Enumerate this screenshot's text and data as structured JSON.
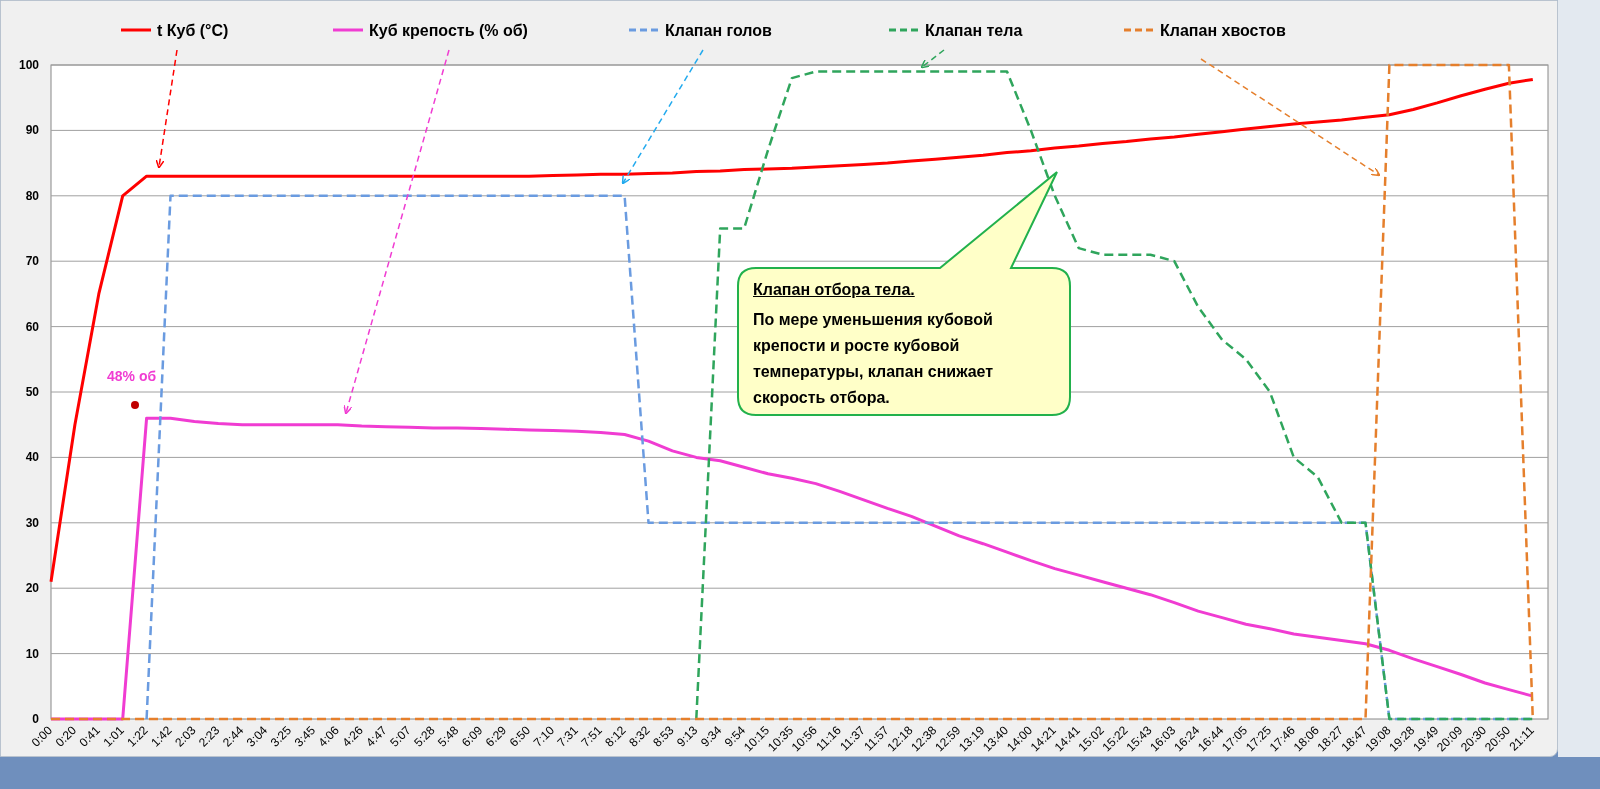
{
  "chart_data": {
    "type": "line",
    "categories": [
      "0:00",
      "0:20",
      "0:41",
      "1:01",
      "1:22",
      "1:42",
      "2:03",
      "2:23",
      "2:44",
      "3:04",
      "3:25",
      "3:45",
      "4:06",
      "4:26",
      "4:47",
      "5:07",
      "5:28",
      "5:48",
      "6:09",
      "6:29",
      "6:50",
      "7:10",
      "7:31",
      "7:51",
      "8:12",
      "8:32",
      "8:53",
      "9:13",
      "9:34",
      "9:54",
      "10:15",
      "10:35",
      "10:56",
      "11:16",
      "11:37",
      "11:57",
      "12:18",
      "12:38",
      "12:59",
      "13:19",
      "13:40",
      "14:00",
      "14:21",
      "14:41",
      "15:02",
      "15:22",
      "15:43",
      "16:03",
      "16:24",
      "16:44",
      "17:05",
      "17:25",
      "17:46",
      "18:06",
      "18:27",
      "18:47",
      "19:08",
      "19:28",
      "19:49",
      "20:09",
      "20:30",
      "20:50",
      "21:11"
    ],
    "series": [
      {
        "name": "t Куб (°C)",
        "color": "#ff0000",
        "line_style": "solid",
        "values": [
          21,
          45,
          65,
          80,
          83,
          83,
          83,
          83,
          83,
          83,
          83,
          83,
          83,
          83,
          83,
          83,
          83,
          83,
          83,
          83,
          83,
          83.1,
          83.2,
          83.3,
          83.3,
          83.4,
          83.5,
          83.7,
          83.8,
          84,
          84.1,
          84.2,
          84.4,
          84.6,
          84.8,
          85,
          85.3,
          85.6,
          85.9,
          86.2,
          86.6,
          86.9,
          87.3,
          87.6,
          88,
          88.3,
          88.7,
          89,
          89.4,
          89.8,
          90.2,
          90.6,
          91,
          91.3,
          91.6,
          92,
          92.4,
          93.2,
          94.2,
          95.3,
          96.3,
          97.2,
          97.8
        ]
      },
      {
        "name": "Куб крепость (% об)",
        "color": "#f03cd2",
        "line_style": "solid",
        "values": [
          0,
          0,
          0,
          0,
          46,
          46,
          45.5,
          45.2,
          45,
          45,
          45,
          45,
          45,
          44.8,
          44.7,
          44.6,
          44.5,
          44.5,
          44.4,
          44.3,
          44.2,
          44.1,
          44,
          43.8,
          43.5,
          42.5,
          41,
          40,
          39.5,
          38.5,
          37.5,
          36.8,
          36,
          34.8,
          33.5,
          32.2,
          31,
          29.5,
          28,
          26.8,
          25.5,
          24.2,
          23,
          22,
          21,
          20,
          19,
          17.8,
          16.5,
          15.5,
          14.5,
          13.8,
          13,
          12.5,
          12,
          11.5,
          10.5,
          9.2,
          8,
          6.8,
          5.5,
          4.5,
          3.5
        ]
      },
      {
        "name": "Клапан голов",
        "color": "#6a9be0",
        "line_style": "dashed",
        "values": [
          null,
          null,
          null,
          null,
          0,
          80,
          80,
          80,
          80,
          80,
          80,
          80,
          80,
          80,
          80,
          80,
          80,
          80,
          80,
          80,
          80,
          80,
          80,
          80,
          80,
          30,
          30,
          30,
          30,
          30,
          30,
          30,
          30,
          30,
          30,
          30,
          30,
          30,
          30,
          30,
          30,
          30,
          30,
          30,
          30,
          30,
          30,
          30,
          30,
          30,
          30,
          30,
          30,
          30,
          30,
          30,
          0,
          0,
          0,
          0,
          0,
          0,
          0
        ]
      },
      {
        "name": "Клапан тела",
        "color": "#2fa55c",
        "line_style": "dashed",
        "values": [
          null,
          null,
          null,
          null,
          null,
          null,
          null,
          null,
          null,
          null,
          null,
          null,
          null,
          null,
          null,
          null,
          null,
          null,
          null,
          null,
          null,
          null,
          null,
          null,
          null,
          null,
          null,
          0,
          75,
          75,
          87,
          98,
          99,
          99,
          99,
          99,
          99,
          99,
          99,
          99,
          99,
          90,
          80,
          72,
          71,
          71,
          71,
          70,
          63,
          58,
          55,
          50,
          40,
          37,
          30,
          30,
          0,
          0,
          0,
          0,
          0,
          0,
          0
        ]
      },
      {
        "name": "Клапан хвостов",
        "color": "#e57f2c",
        "line_style": "dashed",
        "values": [
          0,
          0,
          0,
          0,
          0,
          0,
          0,
          0,
          0,
          0,
          0,
          0,
          0,
          0,
          0,
          0,
          0,
          0,
          0,
          0,
          0,
          0,
          0,
          0,
          0,
          0,
          0,
          0,
          0,
          0,
          0,
          0,
          0,
          0,
          0,
          0,
          0,
          0,
          0,
          0,
          0,
          0,
          0,
          0,
          0,
          0,
          0,
          0,
          0,
          0,
          0,
          0,
          0,
          0,
          0,
          0,
          100,
          100,
          100,
          100,
          100,
          100,
          0
        ]
      }
    ],
    "ylim": [
      0,
      100
    ],
    "yticks": [
      0,
      10,
      20,
      30,
      40,
      50,
      60,
      70,
      80,
      90,
      100
    ],
    "grid": true,
    "legend": true,
    "annotations": [
      {
        "text": "48% об"
      },
      {
        "text": "Клапан отбора тела."
      },
      {
        "text": "По мере уменьшения кубовой крепости и росте кубовой температуры, клапан снижает скорость отбора."
      }
    ]
  }
}
